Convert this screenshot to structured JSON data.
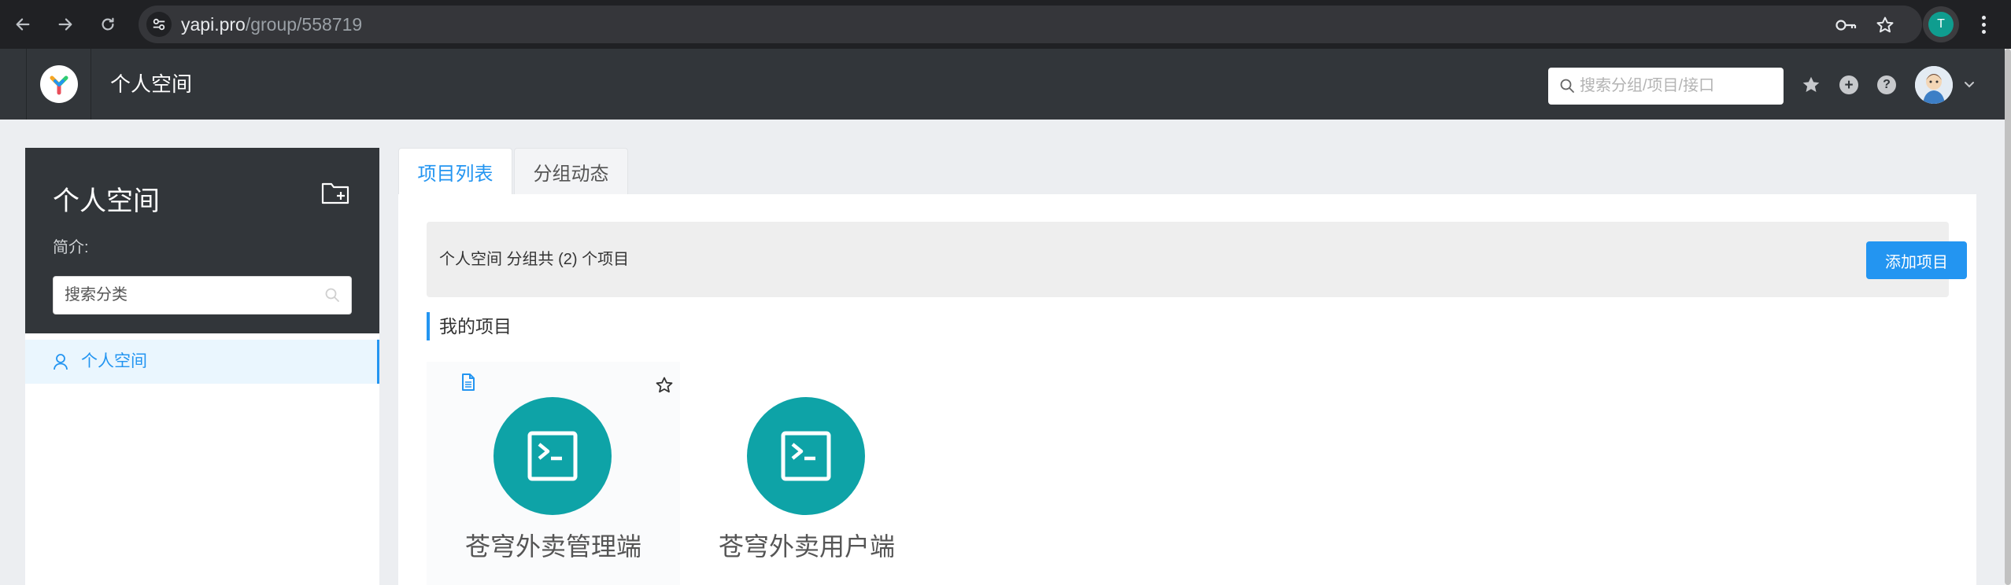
{
  "browser": {
    "url_host": "yapi.pro",
    "url_path": "/group/558719",
    "profile_initial": "T"
  },
  "header": {
    "title": "个人空间",
    "search_placeholder": "搜索分组/项目/接口"
  },
  "sidebar": {
    "title": "个人空间",
    "desc_label": "简介:",
    "search_placeholder": "搜索分类",
    "items": [
      {
        "label": "个人空间",
        "icon": "user-icon",
        "selected": true
      }
    ]
  },
  "tabs": [
    {
      "label": "项目列表",
      "active": true
    },
    {
      "label": "分组动态",
      "active": false
    }
  ],
  "main": {
    "project_count_text": "个人空间 分组共 (2) 个项目",
    "add_project_label": "添加项目",
    "section_title": "我的项目",
    "projects": [
      {
        "name": "苍穹外卖管理端",
        "icon": "terminal-icon"
      },
      {
        "name": "苍穹外卖用户端",
        "icon": "terminal-icon"
      }
    ]
  },
  "colors": {
    "accent": "#2395f1",
    "header_bg": "#32363a",
    "project_logo": "#0ea3a7"
  }
}
